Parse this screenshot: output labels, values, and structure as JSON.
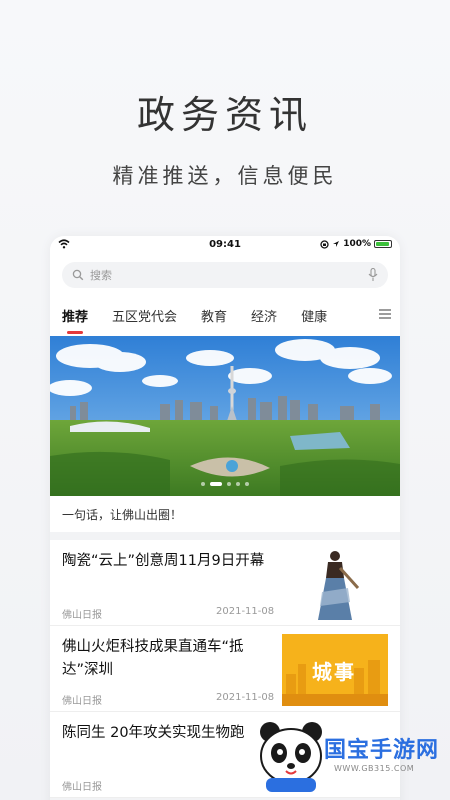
{
  "hero": {
    "title": "政务资讯",
    "subtitle": "精准推送，信息便民"
  },
  "statusbar": {
    "time": "09:41",
    "battery": "100%"
  },
  "search": {
    "placeholder": "搜索"
  },
  "tabs": [
    {
      "label": "推荐",
      "active": true
    },
    {
      "label": "五区党代会"
    },
    {
      "label": "教育"
    },
    {
      "label": "经济"
    },
    {
      "label": "健康"
    }
  ],
  "banner": {
    "caption": "一句话，让佛山出圈！",
    "slides": 5,
    "active_slide": 1
  },
  "news": [
    {
      "title": "陶瓷“云上”创意周11月9日开幕",
      "source": "佛山日报",
      "date": "2021-11-08",
      "thumb": "ceramic-figure"
    },
    {
      "title": "佛山火炬科技成果直通车“抵达”深圳",
      "source": "佛山日报",
      "date": "2021-11-08",
      "thumb": "city-graphic",
      "thumb_text": "城事"
    },
    {
      "title": "陈同生 20年攻关实现生物跑",
      "source": "佛山日报",
      "date": ""
    }
  ],
  "watermark": {
    "name": "国宝手游网",
    "url": "WWW.GB315.COM"
  },
  "colors": {
    "accent": "#e4393c",
    "watermark": "#2b6fe0"
  }
}
